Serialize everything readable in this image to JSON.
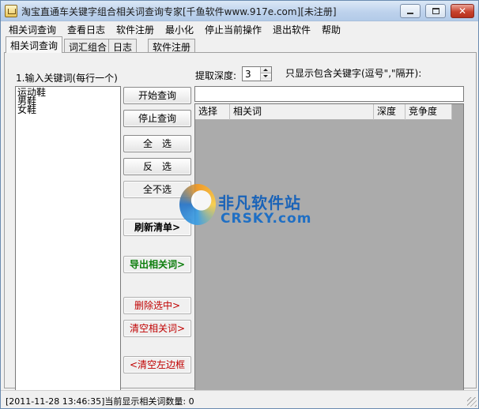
{
  "window": {
    "title": "淘宝直通车关键字组合相关词查询专家[千鱼软件www.917e.com][未注册]",
    "controls": {
      "minimize": "minimize-icon",
      "maximize": "maximize-icon",
      "close": "✕"
    }
  },
  "menu": [
    "相关词查询",
    "查看日志",
    "软件注册",
    "最小化",
    "停止当前操作",
    "退出软件",
    "帮助"
  ],
  "tabs": [
    "相关词查询",
    "词汇组合",
    "日志",
    "软件注册"
  ],
  "left": {
    "label": "1.输入关键词(每行一个)",
    "keywords": [
      "运动鞋",
      "男鞋",
      "女鞋"
    ]
  },
  "buttons": {
    "start": "开始查询",
    "stop": "停止查询",
    "select_all": "全　选",
    "invert": "反　选",
    "select_none": "全不选",
    "refresh": "刷新清单>",
    "export": "导出相关词>",
    "delete_selected": "删除选中>",
    "clear_related": "清空相关词>",
    "clear_left": "<清空左边框"
  },
  "depth": {
    "label": "提取深度:",
    "value": "3"
  },
  "filter": {
    "label": "只显示包含关键字(逗号\",\"隔开):",
    "value": ""
  },
  "grid": {
    "columns": [
      "选择",
      "相关词",
      "深度",
      "竞争度"
    ]
  },
  "watermark": {
    "cn": "非凡软件站",
    "en": "CRSKY.com"
  },
  "status": "[2011-11-28 13:46:35]当前显示相关词数量: 0",
  "colors": {
    "export_text": "#0b7d0b",
    "danger_text": "#c00000",
    "grid_bg": "#ababab"
  }
}
